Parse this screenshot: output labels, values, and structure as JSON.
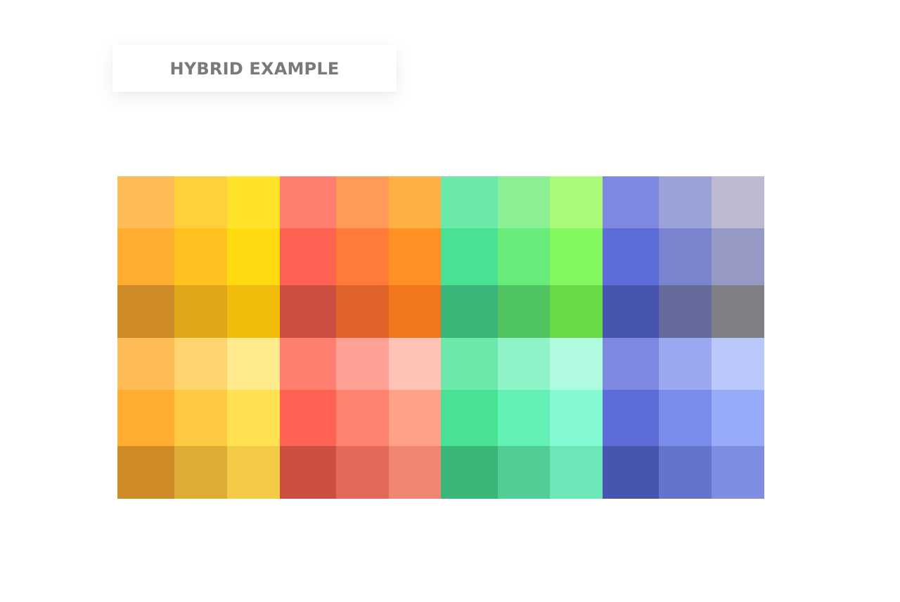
{
  "title_card": {
    "label": "HYBRID EXAMPLE"
  },
  "palette": {
    "rows": [
      [
        "#FFBB55",
        "#FFCF3C",
        "#FFE22A",
        "#FF7E70",
        "#FF9A58",
        "#FFB141",
        "#6BE8AA",
        "#8BF093",
        "#ABF978",
        "#7F88E0",
        "#9AA3D8",
        "#BBBAD1"
      ],
      [
        "#FFAD31",
        "#FFC21F",
        "#FFDA10",
        "#FF6250",
        "#FF7B37",
        "#FF9023",
        "#49E295",
        "#67EC7B",
        "#82F75E",
        "#5E6CDA",
        "#7A83CE",
        "#9599C4"
      ],
      [
        "#CD8A27",
        "#DEA618",
        "#F2BC0D",
        "#CC5042",
        "#E1632C",
        "#F2761C",
        "#3AB778",
        "#51C462",
        "#69DA45",
        "#4755AF",
        "#656B9A",
        "#7F8085"
      ],
      [
        "#FFBB55",
        "#FFD46E",
        "#FFEA8E",
        "#FF7E70",
        "#FFA194",
        "#FFC3B5",
        "#6BE8AA",
        "#90F3C8",
        "#B1FCE1",
        "#7F88E0",
        "#9BA7EE",
        "#BBC8FC"
      ],
      [
        "#FFAD31",
        "#FFCA42",
        "#FFE151",
        "#FF6250",
        "#FF8170",
        "#FFA089",
        "#49E295",
        "#63F0B4",
        "#84FAD4",
        "#5E6CDA",
        "#7A8CEA",
        "#97ABF8"
      ],
      [
        "#CD8A27",
        "#DEAB35",
        "#F2CA45",
        "#CC5042",
        "#E3695A",
        "#F08672",
        "#3AB778",
        "#52CE95",
        "#6BE7B8",
        "#4755AF",
        "#6574CA",
        "#7E8DE2"
      ]
    ]
  }
}
